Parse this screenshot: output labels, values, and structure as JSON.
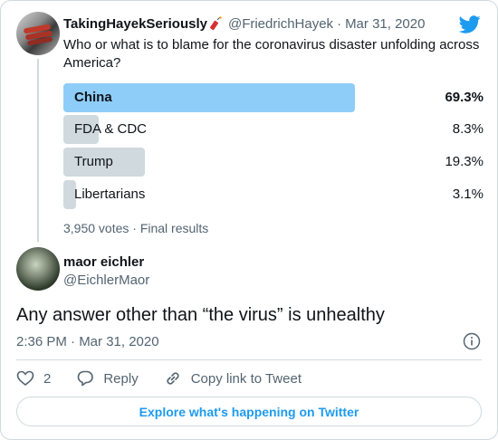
{
  "parent_tweet": {
    "author_name": "TakingHayekSeriously",
    "handle": "@FriedrichHayek",
    "separator": "·",
    "date": "Mar 31, 2020",
    "text": "Who or what is to blame for the coronavirus disaster unfolding across America?",
    "poll": {
      "options": [
        {
          "label": "China",
          "percent_text": "69.3%",
          "percent": 69.3,
          "winner": true
        },
        {
          "label": "FDA & CDC",
          "percent_text": "8.3%",
          "percent": 8.3,
          "winner": false
        },
        {
          "label": "Trump",
          "percent_text": "19.3%",
          "percent": 19.3,
          "winner": false
        },
        {
          "label": "Libertarians",
          "percent_text": "3.1%",
          "percent": 3.1,
          "winner": false
        }
      ],
      "meta": "3,950 votes · Final results"
    }
  },
  "tweet": {
    "author_name": "maor eichler",
    "handle": "@EichlerMaor",
    "text": "Any answer other than “the virus” is unhealthy",
    "time": "2:36 PM · Mar 31, 2020"
  },
  "actions": {
    "like_count": "2",
    "reply_label": "Reply",
    "copy_link_label": "Copy link to Tweet"
  },
  "explore_label": "Explore what's happening on Twitter",
  "colors": {
    "twitter_blue": "#1d9bf0",
    "poll_winner": "#8ecdf8",
    "poll_other": "#cfd9de",
    "secondary_text": "#536471"
  }
}
